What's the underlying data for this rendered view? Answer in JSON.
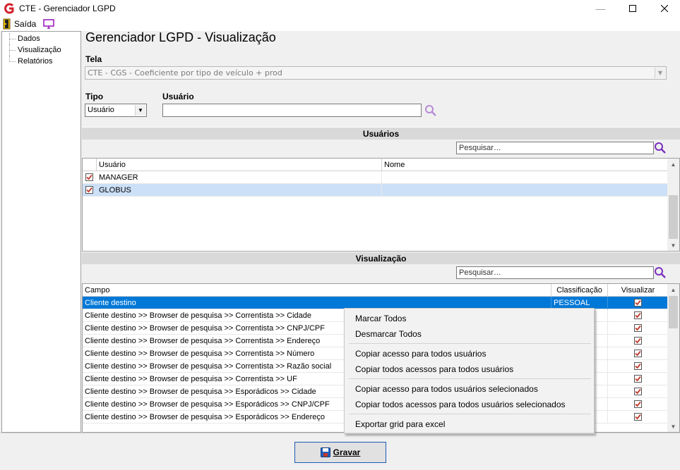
{
  "window": {
    "title": "CTE - Gerenciador LGPD"
  },
  "menubar": {
    "exit_label": "Saída"
  },
  "tree": {
    "items": [
      "Dados",
      "Visualização",
      "Relatórios"
    ]
  },
  "main": {
    "title": "Gerenciador LGPD - Visualização",
    "tela_label": "Tela",
    "tela_value": "CTE - CGS - Coeficiente por tipo de veículo + prod",
    "tipo_label": "Tipo",
    "tipo_value": "Usuário",
    "usuario_label": "Usuário",
    "usuario_value": ""
  },
  "usuarios_section": {
    "header": "Usuários",
    "search_placeholder": "Pesquisar…",
    "columns": [
      "Usuário",
      "Nome"
    ],
    "rows": [
      {
        "usuario": "MANAGER",
        "nome": "",
        "checked": true,
        "selected": false
      },
      {
        "usuario": "GLOBUS",
        "nome": "",
        "checked": true,
        "selected": true
      }
    ]
  },
  "visualizacao_section": {
    "header": "Visualização",
    "search_placeholder": "Pesquisar…",
    "columns": [
      "Campo",
      "Classificação",
      "Visualizar"
    ],
    "rows": [
      {
        "campo": "Cliente destino",
        "classificacao": "PESSOAL",
        "checked": true,
        "selected": true
      },
      {
        "campo": "Cliente destino >> Browser de pesquisa >> Correntista >> Cidade",
        "classificacao": "",
        "checked": true,
        "selected": false
      },
      {
        "campo": "Cliente destino >> Browser de pesquisa >> Correntista >> CNPJ/CPF",
        "classificacao": "",
        "checked": true,
        "selected": false
      },
      {
        "campo": "Cliente destino >> Browser de pesquisa >> Correntista >> Endereço",
        "classificacao": "",
        "checked": true,
        "selected": false
      },
      {
        "campo": "Cliente destino >> Browser de pesquisa >> Correntista >> Número",
        "classificacao": "",
        "checked": true,
        "selected": false
      },
      {
        "campo": "Cliente destino >> Browser de pesquisa >> Correntista >> Razão social",
        "classificacao": "",
        "checked": true,
        "selected": false
      },
      {
        "campo": "Cliente destino >> Browser de pesquisa >> Correntista >> UF",
        "classificacao": "",
        "checked": true,
        "selected": false
      },
      {
        "campo": "Cliente destino >> Browser de pesquisa >> Esporádicos >> Cidade",
        "classificacao": "",
        "checked": true,
        "selected": false
      },
      {
        "campo": "Cliente destino >> Browser de pesquisa >> Esporádicos >> CNPJ/CPF",
        "classificacao": "",
        "checked": true,
        "selected": false
      },
      {
        "campo": "Cliente destino >> Browser de pesquisa >> Esporádicos >> Endereço",
        "classificacao": "",
        "checked": true,
        "selected": false
      }
    ]
  },
  "context_menu": {
    "items": [
      "Marcar Todos",
      "Desmarcar Todos",
      "Copiar acesso para todos usuários",
      "Copiar todos acessos para todos usuários",
      "Copiar acesso para todos usuários selecionados",
      "Copiar todos acessos para todos usuários selecionados",
      "Exportar grid para excel"
    ]
  },
  "footer": {
    "save_label": "Gravar"
  },
  "colors": {
    "selection": "#0078d7",
    "selection_light": "#cce0f7",
    "check_red": "#c0392b",
    "search_icon": "#7b2fbe",
    "logo_red": "#d4202c"
  },
  "icons": {
    "logo": "app-logo-icon",
    "exit": "exit-door-icon",
    "monitor": "monitor-icon",
    "search": "search-icon",
    "save": "floppy-disk-icon"
  }
}
